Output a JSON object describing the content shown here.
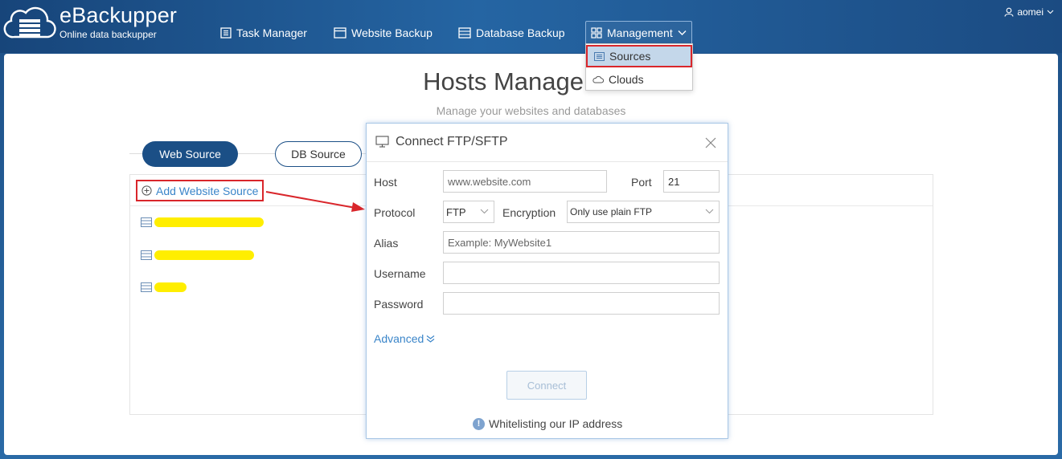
{
  "header": {
    "brand": "eBackupper",
    "tagline": "Online data backupper",
    "nav": {
      "task_manager": "Task Manager",
      "website_backup": "Website Backup",
      "database_backup": "Database Backup",
      "management": "Management"
    },
    "user": "aomei"
  },
  "management_menu": {
    "items": [
      {
        "label": "Sources",
        "icon": "list-icon",
        "selected": true
      },
      {
        "label": "Clouds",
        "icon": "cloud-icon",
        "selected": false
      }
    ]
  },
  "page": {
    "title": "Hosts Management",
    "subtitle": "Manage your websites and databases",
    "tabs": {
      "web_source": "Web Source",
      "db_source": "DB Source"
    },
    "add_source": "Add Website Source"
  },
  "modal": {
    "title": "Connect FTP/SFTP",
    "host_label": "Host",
    "host_placeholder": "www.website.com",
    "port_label": "Port",
    "port_value": "21",
    "protocol_label": "Protocol",
    "protocol_value": "FTP",
    "encryption_label": "Encryption",
    "encryption_value": "Only use plain FTP",
    "alias_label": "Alias",
    "alias_placeholder": "Example: MyWebsite1",
    "username_label": "Username",
    "password_label": "Password",
    "advanced": "Advanced",
    "connect": "Connect",
    "whitelist": "Whitelisting our IP address"
  },
  "colors": {
    "header_bg": "#1d4f86",
    "accent": "#1b4f86",
    "link": "#3a85c9",
    "highlight_border": "#d9262b",
    "redaction": "#ffee00"
  }
}
